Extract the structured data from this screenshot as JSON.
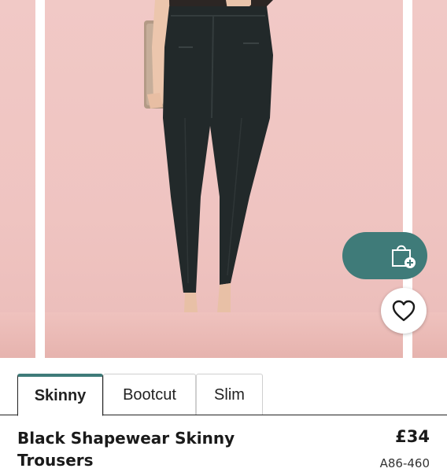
{
  "product": {
    "title": "Black Shapewear Skinny Trousers",
    "price": "£34",
    "code": "A86-460",
    "image_alt": "Model wearing black high-waisted skinny trousers holding a clutch bag"
  },
  "tabs": [
    {
      "label": "Skinny",
      "active": true
    },
    {
      "label": "Bootcut",
      "active": false
    },
    {
      "label": "Slim",
      "active": false
    }
  ],
  "actions": {
    "add_to_bag_icon": "shopping-bag-plus-icon",
    "wishlist_icon": "heart-outline-icon"
  },
  "colors": {
    "accent": "#3f7b79",
    "backdrop": "#f1c9c6",
    "garment": "#22292a"
  }
}
